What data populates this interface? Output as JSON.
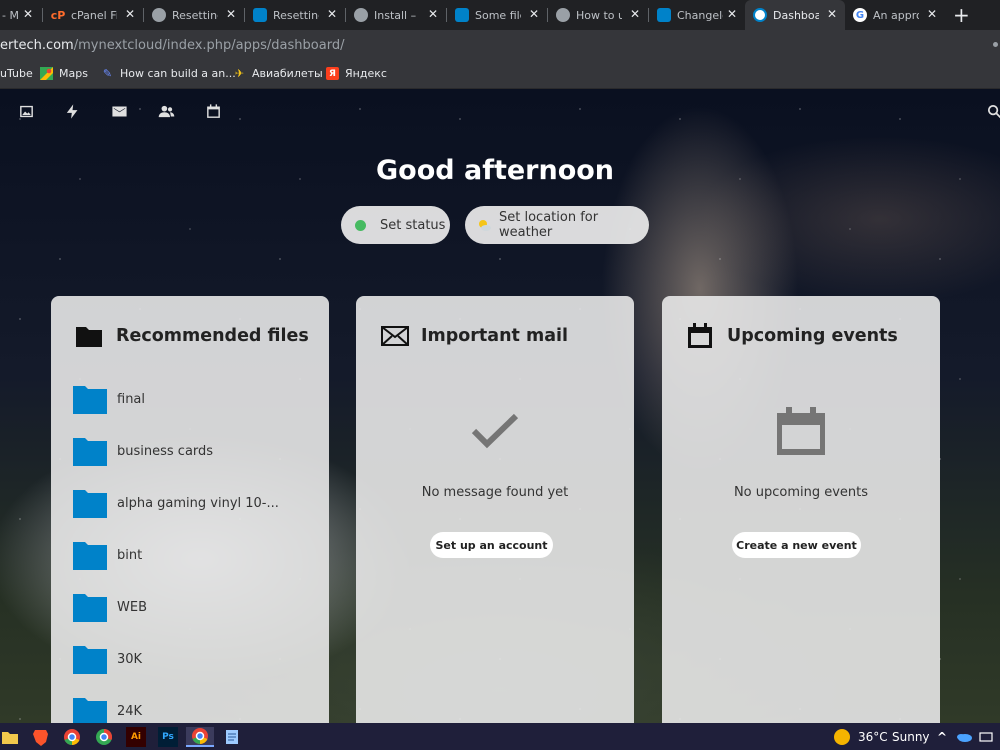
{
  "browser": {
    "tabs": [
      {
        "title": "- M",
        "icon": "page-icon"
      },
      {
        "title": "cPanel File",
        "icon": "cpanel-icon"
      },
      {
        "title": "Resetting",
        "icon": "globe-icon"
      },
      {
        "title": "Resetting",
        "icon": "nextcloud-icon"
      },
      {
        "title": "Install – N",
        "icon": "globe-icon"
      },
      {
        "title": "Some file",
        "icon": "nextcloud-icon"
      },
      {
        "title": "How to u",
        "icon": "globe-icon"
      },
      {
        "title": "Changelo",
        "icon": "nextcloud-icon"
      },
      {
        "title": "Dashboa",
        "icon": "nextcloud-icon",
        "active": true
      },
      {
        "title": "An appro",
        "icon": "google-icon"
      }
    ],
    "url_host": "ertech.com",
    "url_path": "/mynextcloud/index.php/apps/dashboard/",
    "bookmarks": [
      {
        "label": "uTube"
      },
      {
        "label": "Maps"
      },
      {
        "label": "How can build a an..."
      },
      {
        "label": "Авиабилеты"
      },
      {
        "label": "Яндекс"
      }
    ]
  },
  "dashboard": {
    "greeting": "Good afternoon",
    "set_status": "Set status",
    "set_location": "Set location for weather"
  },
  "files_card": {
    "title": "Recommended files",
    "files": [
      "final",
      "business cards",
      "alpha gaming vinyl 10-...",
      "bint",
      "WEB",
      "30K",
      "24K"
    ]
  },
  "mail_card": {
    "title": "Important mail",
    "empty": "No message found yet",
    "button": "Set up an account"
  },
  "events_card": {
    "title": "Upcoming events",
    "empty": "No upcoming events",
    "button": "Create a new event"
  },
  "taskbar": {
    "weather_temp": "36°C",
    "weather_desc": "Sunny"
  },
  "colors": {
    "folder": "#0082c9",
    "status_dot": "#46ba61",
    "taskbar": "#1f1f3a"
  }
}
